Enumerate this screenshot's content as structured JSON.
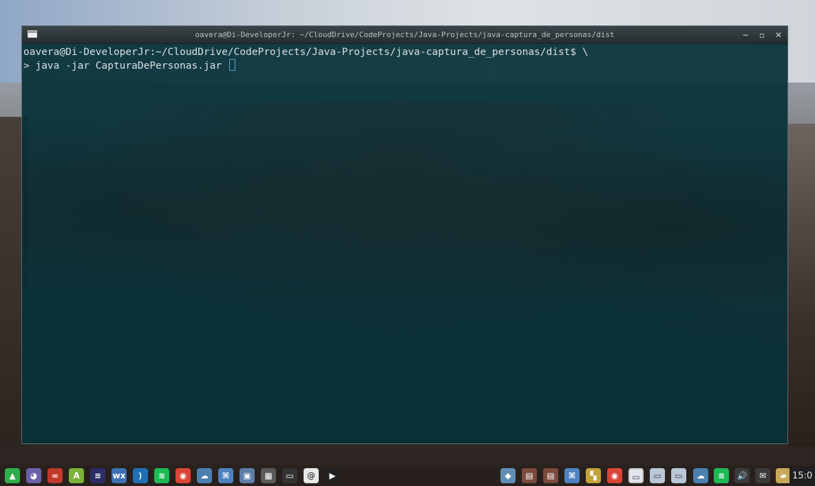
{
  "terminal_window": {
    "title": "oavera@Di-DeveloperJr: ~/CloudDrive/CodeProjects/Java-Projects/java-captura_de_personas/dist",
    "prompt_line": "oavera@Di-DeveloperJr:~/CloudDrive/CodeProjects/Java-Projects/java-captura_de_personas/dist$ \\",
    "command_line": "> java -jar CapturaDePersonas.jar ",
    "controls": {
      "minimize": "−",
      "maximize": "▫",
      "close": "✕"
    }
  },
  "taskbar": {
    "launchers": [
      {
        "name": "app-menu-icon",
        "color": "#2fae4a",
        "glyph": "▲"
      },
      {
        "name": "pidgin-icon",
        "color": "#6b5fa8",
        "glyph": "◕"
      },
      {
        "name": "oo-app-icon",
        "color": "#c0392b",
        "glyph": "∞"
      },
      {
        "name": "android-studio-icon",
        "color": "#7bb33a",
        "glyph": "A"
      },
      {
        "name": "eclipse-icon",
        "color": "#2c2c66",
        "glyph": "≡"
      },
      {
        "name": "wxformbuilder-icon",
        "color": "#3d6fb3",
        "glyph": "wx"
      },
      {
        "name": "vscode-icon",
        "color": "#1f6fb5",
        "glyph": "⟩"
      },
      {
        "name": "spotify-icon",
        "color": "#1db954",
        "glyph": "≋"
      },
      {
        "name": "chrome-icon",
        "color": "#db4437",
        "glyph": "◉"
      },
      {
        "name": "cloud-drive-icon",
        "color": "#4a7fb0",
        "glyph": "☁"
      },
      {
        "name": "network-icon",
        "color": "#4c82c0",
        "glyph": "⌘"
      },
      {
        "name": "remote-desktop-icon",
        "color": "#5b7ea8",
        "glyph": "▣"
      },
      {
        "name": "calculator-icon",
        "color": "#5a5a5a",
        "glyph": "▦"
      },
      {
        "name": "terminal-icon",
        "color": "#333333",
        "glyph": "▭"
      },
      {
        "name": "debian-icon",
        "color": "#e8e8e8",
        "glyph": "@"
      },
      {
        "name": "media-player-icon",
        "color": "#222222",
        "glyph": "▶"
      }
    ],
    "tasks": [
      {
        "name": "virtualbox-task-icon",
        "color": "#5f8fb5",
        "glyph": "◆"
      },
      {
        "name": "calendar-task-icon",
        "color": "#7a4a3c",
        "glyph": "▤"
      },
      {
        "name": "calendar2-task-icon",
        "color": "#7a4a3c",
        "glyph": "▤"
      },
      {
        "name": "network-task-icon",
        "color": "#4c82c0",
        "glyph": "⌘"
      },
      {
        "name": "colors-task-icon",
        "color": "#c4a23a",
        "glyph": "▚"
      },
      {
        "name": "chrome-task-icon",
        "color": "#db4437",
        "glyph": "◉"
      },
      {
        "name": "terminal-window-task",
        "color": "#dfe6ee",
        "glyph": "▭"
      },
      {
        "name": "window-task-2",
        "color": "#b7c7d8",
        "glyph": "▭"
      },
      {
        "name": "window-task-3",
        "color": "#b7c7d8",
        "glyph": "▭"
      }
    ],
    "tray": [
      {
        "name": "cloud-sync-icon",
        "color": "#4a7fb0",
        "glyph": "☁"
      },
      {
        "name": "spotify-tray-icon",
        "color": "#1db954",
        "glyph": "≋"
      },
      {
        "name": "volume-icon",
        "color": "#3a3a3a",
        "glyph": "🔊"
      },
      {
        "name": "mail-icon",
        "color": "#3a3a3a",
        "glyph": "✉"
      },
      {
        "name": "folder-icon",
        "color": "#c8a85a",
        "glyph": "▰"
      }
    ],
    "clock": "15:0"
  }
}
